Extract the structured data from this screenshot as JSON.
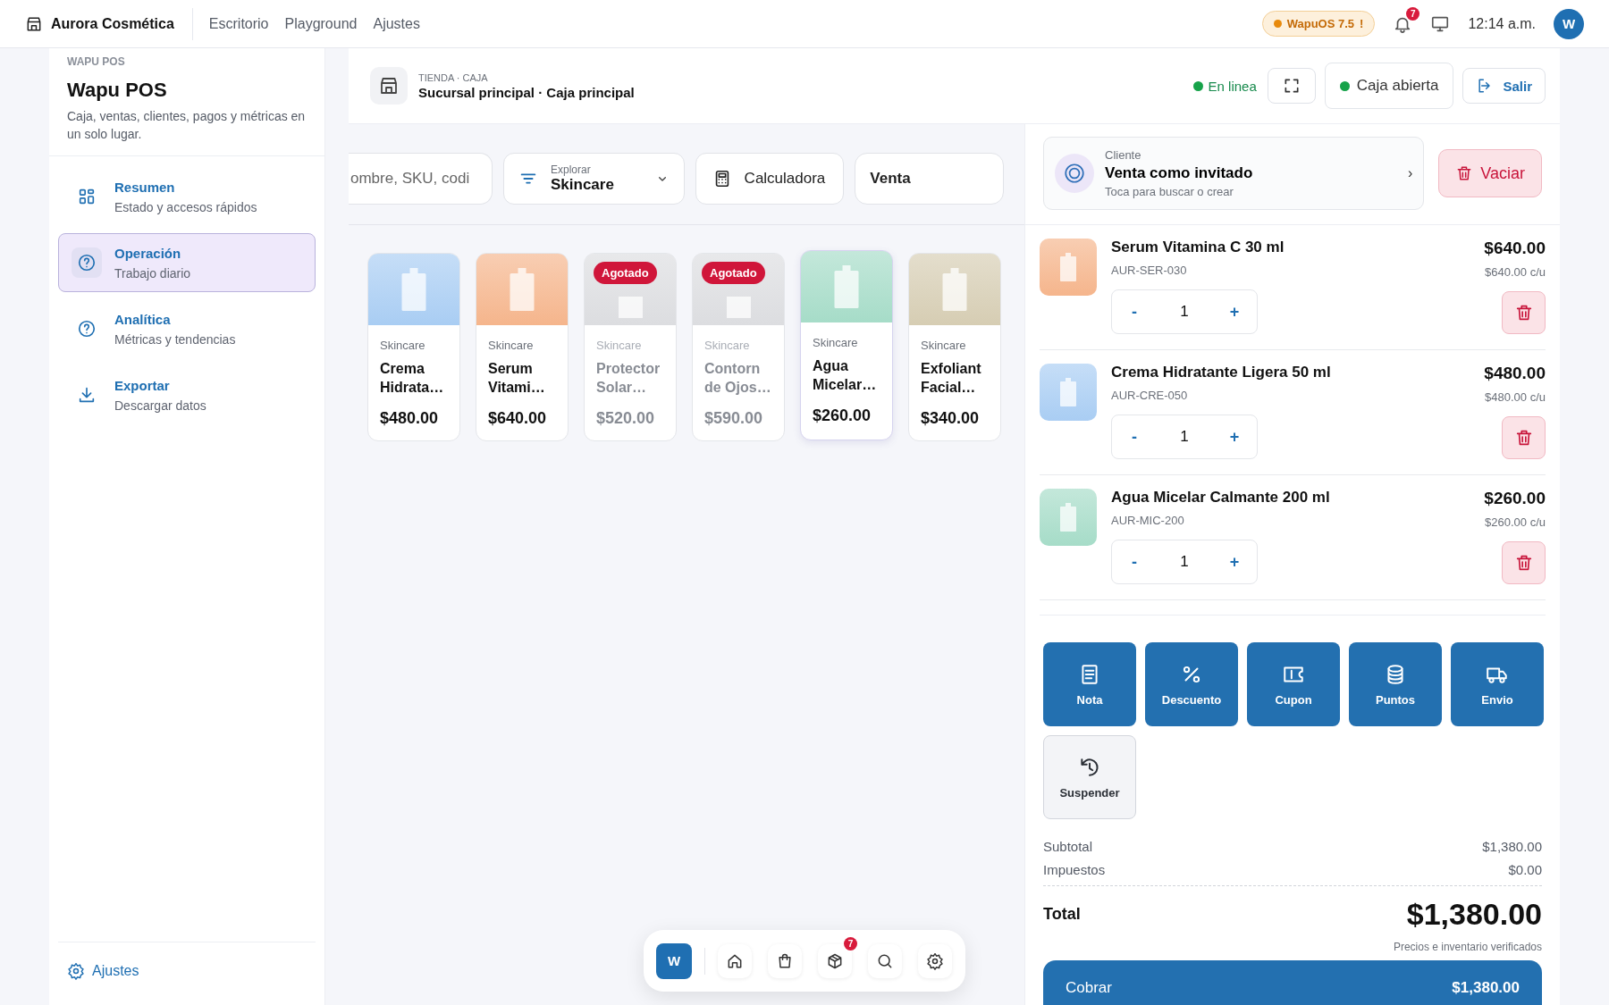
{
  "topbar": {
    "brand": "Aurora Cosmética",
    "nav": [
      {
        "label": "Escritorio"
      },
      {
        "label": "Playground"
      },
      {
        "label": "Ajustes"
      }
    ],
    "version_badge": "WapuOS 7.5",
    "version_alert": "!",
    "notification_count": "7",
    "time": "12:14 a.m.",
    "avatar": "W"
  },
  "sidebar": {
    "eyebrow": "WAPU POS",
    "title": "Wapu POS",
    "description": "Caja, ventas, clientes, pagos y métricas en un solo lugar.",
    "items": [
      {
        "label": "Resumen",
        "sublabel": "Estado y accesos rápidos",
        "selected": false
      },
      {
        "label": "Operación",
        "sublabel": "Trabajo diario",
        "selected": true
      },
      {
        "label": "Analítica",
        "sublabel": "Métricas y tendencias",
        "selected": false
      },
      {
        "label": "Exportar",
        "sublabel": "Descargar datos",
        "selected": false
      }
    ],
    "footer": "Ajustes"
  },
  "header": {
    "eyebrow": "TIENDA · CAJA",
    "location": "Sucursal principal · Caja principal",
    "connection": "En linea",
    "register_status": "Caja abierta",
    "exit": "Salir"
  },
  "toolbar": {
    "search": {
      "placeholder": "ombre, SKU, codi"
    },
    "filter": {
      "label": "Explorar",
      "value": "Skincare"
    },
    "calculator": "Calculadora",
    "mode": "Venta"
  },
  "products": [
    {
      "category": "Skincare",
      "name": "Crema\nHidrata…",
      "price": "$480.00",
      "color": "#a9cdf3",
      "available": true,
      "selected": false
    },
    {
      "category": "Skincare",
      "name": "Serum\nVitami…",
      "price": "$640.00",
      "color": "#f5b58c",
      "available": true,
      "selected": false
    },
    {
      "category": "Skincare",
      "name": "Protector\nSolar…",
      "price": "$520.00",
      "color": "#dcdde0",
      "available": false,
      "badge": "Agotado",
      "selected": false
    },
    {
      "category": "Skincare",
      "name": "Contorn\nde Ojos…",
      "price": "$590.00",
      "color": "#dcdde0",
      "available": false,
      "badge": "Agotado",
      "selected": false
    },
    {
      "category": "Skincare",
      "name": "Agua\nMicelar…",
      "price": "$260.00",
      "color": "#a6dcc8",
      "available": true,
      "selected": true
    },
    {
      "category": "Skincare",
      "name": "Exfoliant\nFacial…",
      "price": "$340.00",
      "color": "#d6cdb3",
      "available": true,
      "selected": false
    }
  ],
  "cart": {
    "client": {
      "label": "Cliente",
      "name": "Venta como invitado",
      "hint": "Toca para buscar o crear",
      "chevron": "›"
    },
    "clear": "Vaciar",
    "items": [
      {
        "name": "Serum Vitamina C 30 ml",
        "sku": "AUR-SER-030",
        "decrement": "-",
        "quantity": "1",
        "increment": "+",
        "price": "$640.00",
        "unit_price": "$640.00 c/u",
        "color": "#f5b58c"
      },
      {
        "name": "Crema Hidratante Ligera 50 ml",
        "sku": "AUR-CRE-050",
        "decrement": "-",
        "quantity": "1",
        "increment": "+",
        "price": "$480.00",
        "unit_price": "$480.00 c/u",
        "color": "#a9cdf3"
      },
      {
        "name": "Agua Micelar Calmante 200 ml",
        "sku": "AUR-MIC-200",
        "decrement": "-",
        "quantity": "1",
        "increment": "+",
        "price": "$260.00",
        "unit_price": "$260.00 c/u",
        "color": "#a6dcc8"
      }
    ],
    "actions": [
      {
        "label": "Nota",
        "kind": "primary"
      },
      {
        "label": "Descuento",
        "kind": "primary"
      },
      {
        "label": "Cupon",
        "kind": "primary"
      },
      {
        "label": "Puntos",
        "kind": "primary"
      },
      {
        "label": "Envio",
        "kind": "primary"
      },
      {
        "label": "Suspender",
        "kind": "secondary"
      }
    ],
    "summary": {
      "subtotal_label": "Subtotal",
      "subtotal": "$1,380.00",
      "tax_label": "Impuestos",
      "tax": "$0.00",
      "total_label": "Total",
      "total": "$1,380.00",
      "note": "Precios e inventario verificados"
    },
    "charge": {
      "label": "Cobrar",
      "amount": "$1,380.00"
    }
  },
  "dock": {
    "avatar": "W",
    "package_badge": "7"
  }
}
